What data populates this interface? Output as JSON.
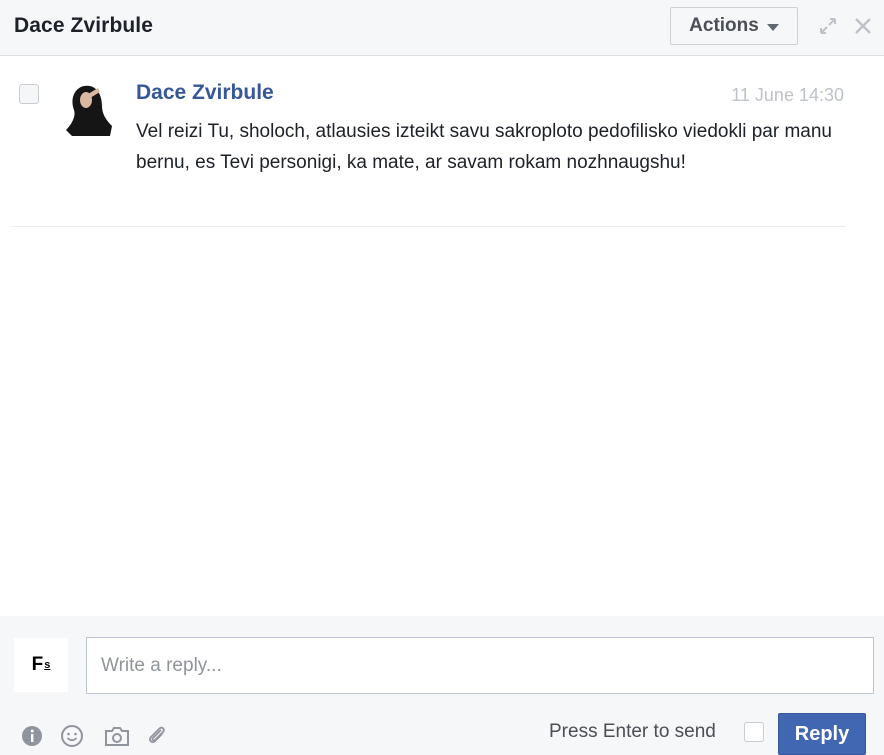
{
  "header": {
    "title": "Dace Zvirbule",
    "actions_label": "Actions",
    "icons": [
      "expand-icon",
      "close-icon"
    ]
  },
  "message": {
    "sender": "Dace Zvirbule",
    "timestamp": "11 June 14:30",
    "body": "Vel reizi Tu, sholoch, atlausies izteikt savu sakroploto pedofilisko viedokli par manu bernu, es Tevi personigi, ka mate, ar savam rokam nozhnaugshu!"
  },
  "composer": {
    "logo_text": "F",
    "logo_sup": "s",
    "reply_placeholder": "Write a reply...",
    "reply_value": "",
    "press_enter_label": "Press Enter to send",
    "reply_button": "Reply",
    "tool_icons": [
      "info-icon",
      "emoji-icon",
      "camera-icon",
      "attach-icon"
    ]
  },
  "colors": {
    "accent": "#4267b2",
    "link": "#365899",
    "header_bg": "#f6f7f9"
  }
}
